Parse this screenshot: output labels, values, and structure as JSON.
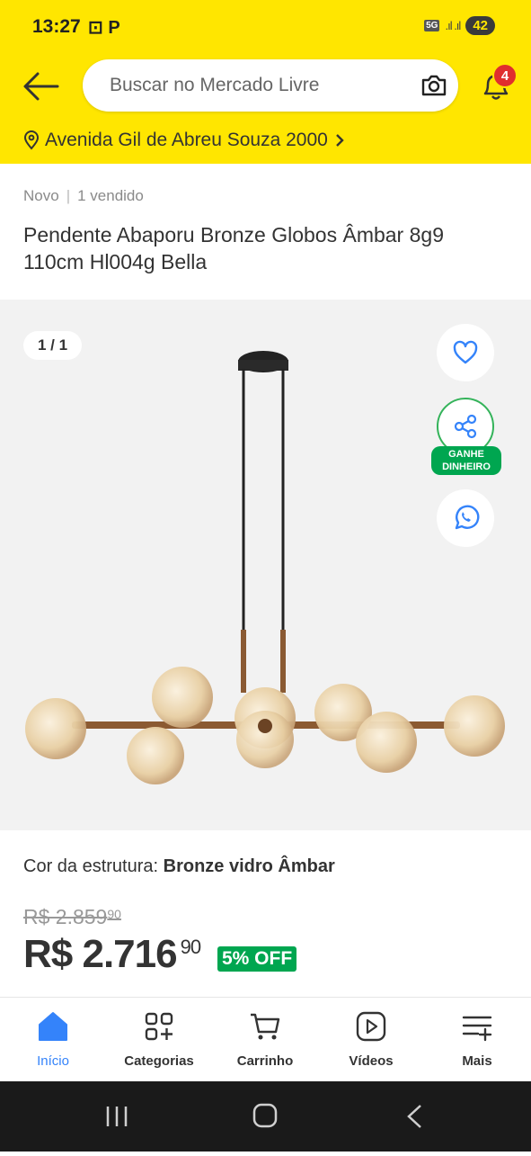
{
  "status_bar": {
    "time": "13:27",
    "app_icons": "⊡ P",
    "network": "5G",
    "battery": "42"
  },
  "header": {
    "search_placeholder": "Buscar no Mercado Livre",
    "notifications_count": "4",
    "address": "Avenida Gil de Abreu Souza 2000"
  },
  "product": {
    "condition": "Novo",
    "sold": "1 vendido",
    "title": "Pendente Abaporu Bronze Globos Âmbar 8g9 110cm Hl004g Bella",
    "image_counter": "1 / 1",
    "earn_label_line1": "GANHE",
    "earn_label_line2": "DINHEIRO",
    "color_label": "Cor da estrutura:",
    "color_value": "Bronze vidro Âmbar",
    "old_price_int": "R$ 2.859",
    "old_price_cents": "90",
    "price_int": "R$ 2.716",
    "price_cents": "90",
    "discount": "5% OFF"
  },
  "bottom_nav": [
    {
      "label": "Início",
      "icon": "home-icon",
      "active": true
    },
    {
      "label": "Categorias",
      "icon": "categories-icon"
    },
    {
      "label": "Carrinho",
      "icon": "cart-icon"
    },
    {
      "label": "Vídeos",
      "icon": "video-icon"
    },
    {
      "label": "Mais",
      "icon": "more-icon"
    }
  ],
  "colors": {
    "brand_yellow": "#ffe600",
    "accent_blue": "#3483fa",
    "discount_green": "#00a650",
    "badge_red": "#e02e2e"
  }
}
